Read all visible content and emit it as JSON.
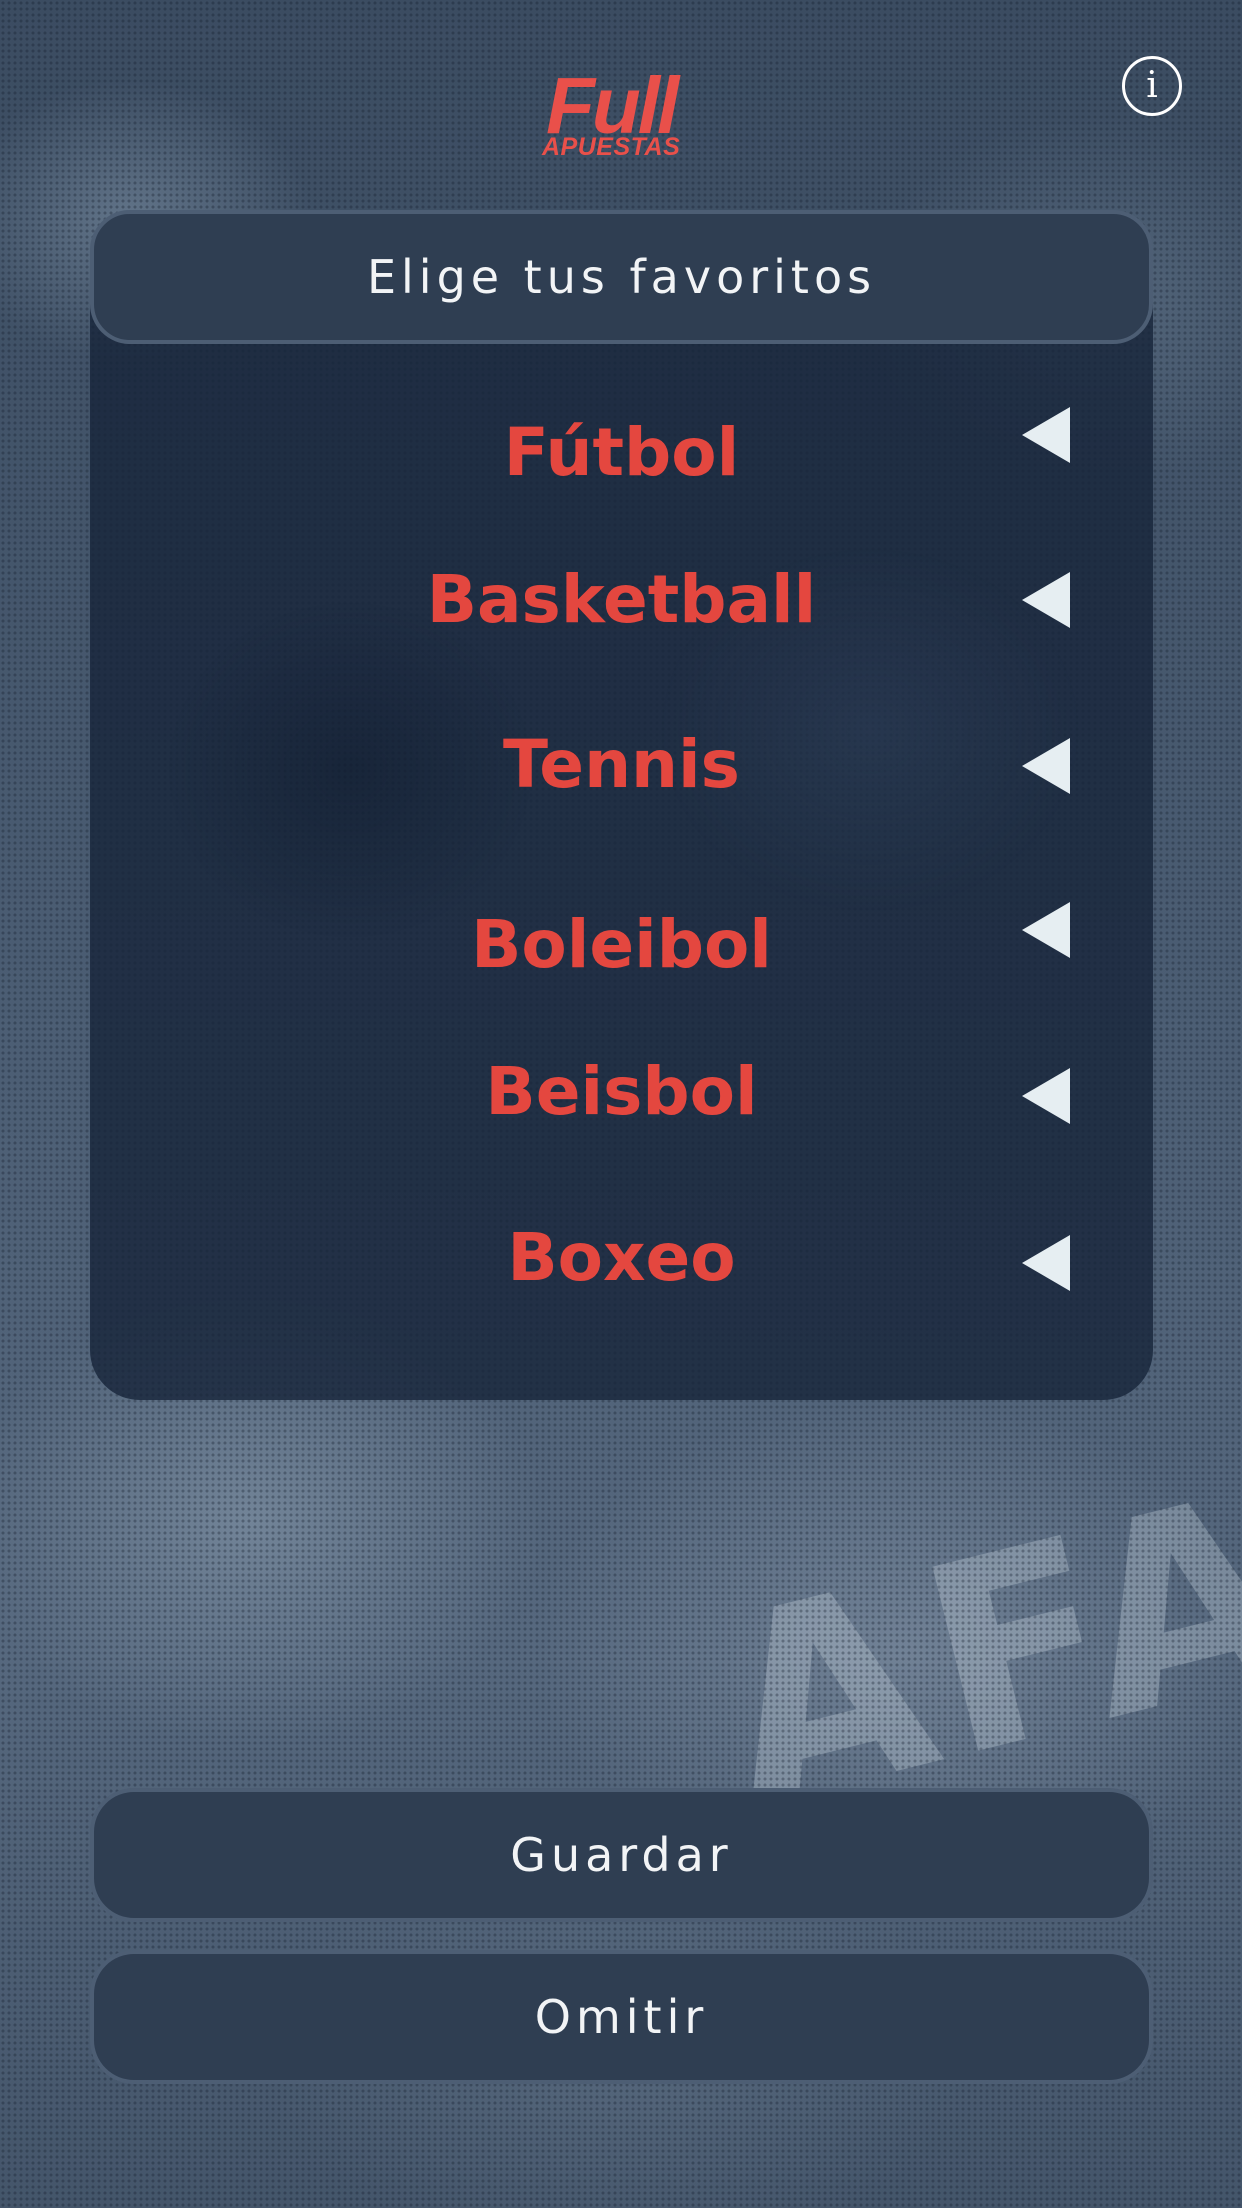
{
  "header": {
    "logo_text": "Full",
    "logo_subtext": "APUESTAS",
    "info_icon": "info-icon",
    "info_glyph": "i"
  },
  "background": {
    "watermark_text": "AFA"
  },
  "favorites": {
    "title": "Elige tus favoritos",
    "items": [
      {
        "label": "Fútbol",
        "icon": "triangle-left-icon"
      },
      {
        "label": "Basketball",
        "icon": "triangle-left-icon"
      },
      {
        "label": "Tennis",
        "icon": "triangle-left-icon"
      },
      {
        "label": "Boleibol",
        "icon": "triangle-left-icon"
      },
      {
        "label": "Beisbol",
        "icon": "triangle-left-icon"
      },
      {
        "label": "Boxeo",
        "icon": "triangle-left-icon"
      }
    ]
  },
  "actions": {
    "save_label": "Guardar",
    "skip_label": "Omitir"
  },
  "colors": {
    "accent": "#e4473f",
    "button_bg": "#2f3e52",
    "panel_bg": "#16243a",
    "text_light": "#f2f4f6"
  }
}
